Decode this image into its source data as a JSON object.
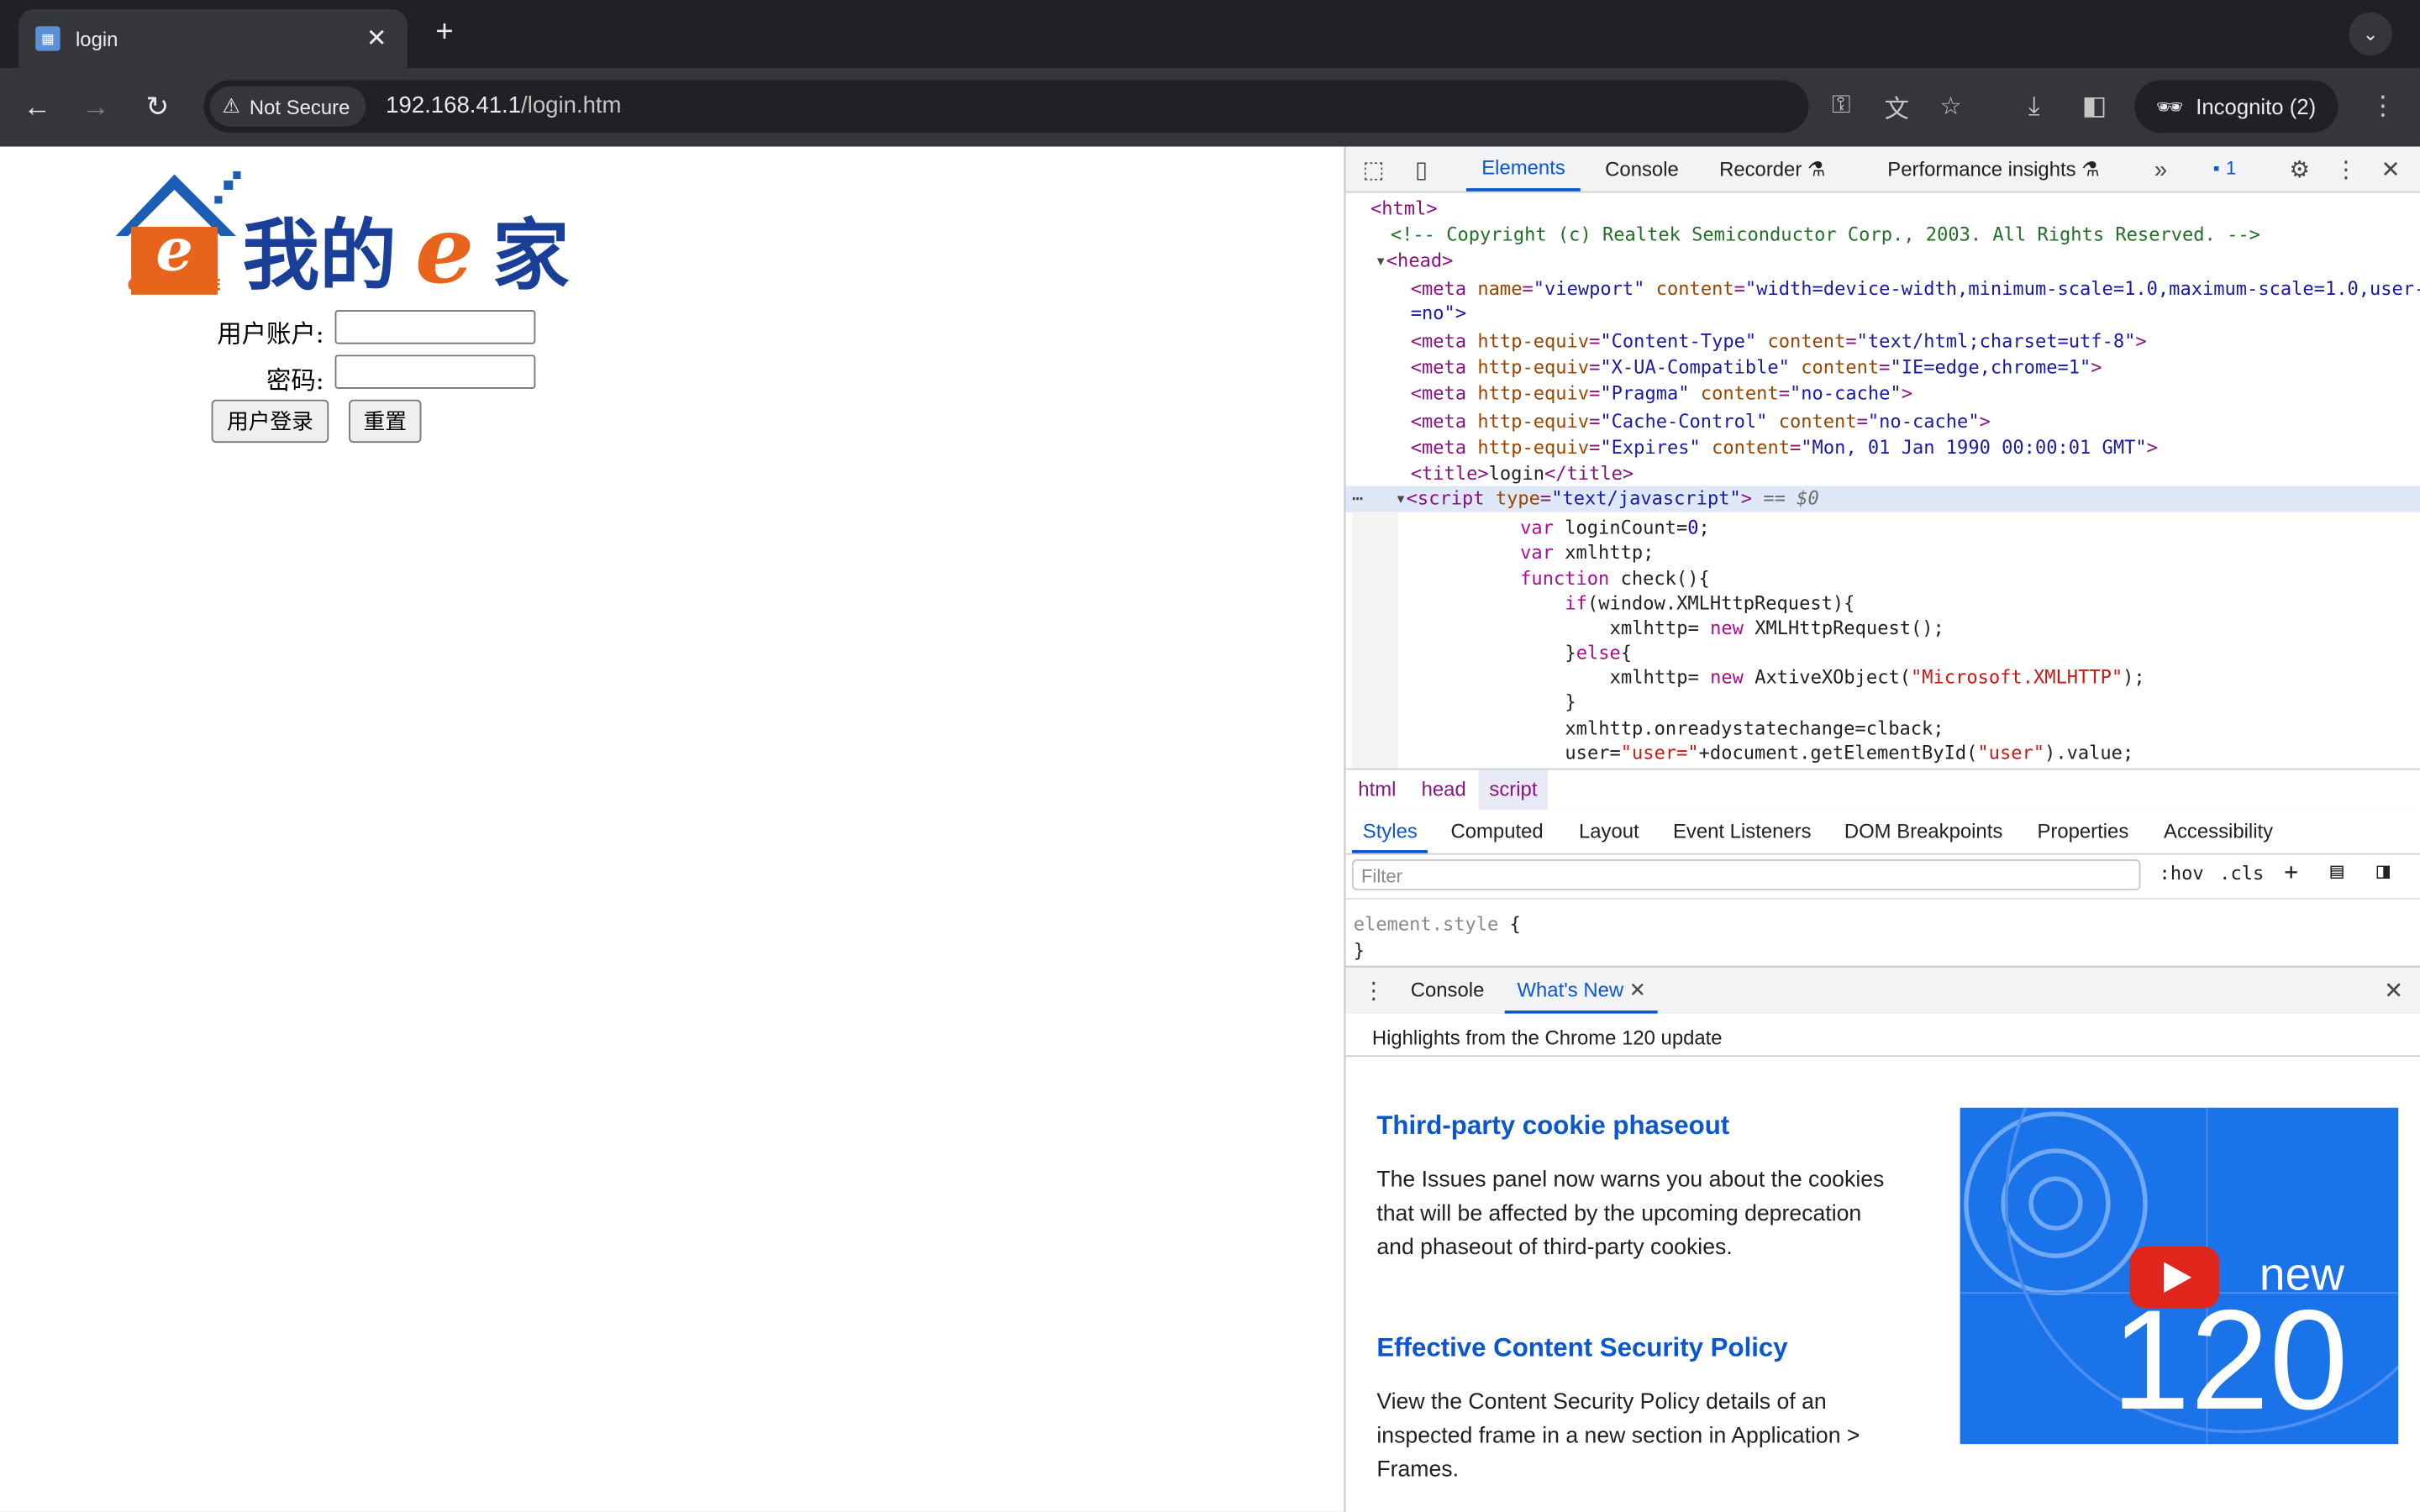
{
  "browser": {
    "tab_title": "login",
    "new_tab": "+",
    "security_label": "Not Secure",
    "url_host": "192.168.41.1",
    "url_path": "/login.htm",
    "incognito_label": "Incognito (2)"
  },
  "page": {
    "logo_text": "我的e家",
    "logo_sub": "ONE HOME",
    "username_label": "用户账户:",
    "password_label": "密码:",
    "username_value": "",
    "password_value": "",
    "login_button": "用户登录",
    "reset_button": "重置"
  },
  "devtools": {
    "tabs": [
      "Elements",
      "Console",
      "Recorder",
      "Performance insights"
    ],
    "issues_count": "1",
    "dom_lines": {
      "l1_tag": "<html>",
      "l2_comment": "<!-- Copyright (c) Realtek Semiconductor Corp., 2003. All Rights Reserved. -->",
      "l3_tag": "<head>",
      "meta1_a": "<meta ",
      "meta1_attr1": "name",
      "meta1_val1": "\"viewport\"",
      "meta1_attr2": "content",
      "meta1_val2": "\"width=device-width,minimum-scale=1.0,maximum-scale=1.0,user-",
      "meta1_cont": "=no\">",
      "meta2_attr1": "http-equiv",
      "meta2_val1": "\"Content-Type\"",
      "meta2_attr2": "content",
      "meta2_val2": "\"text/html;charset=utf-8\"",
      "meta3_val1": "\"X-UA-Compatible\"",
      "meta3_val2": "\"IE=edge,chrome=1\"",
      "meta4_val1": "\"Pragma\"",
      "meta4_val2": "\"no-cache\"",
      "meta5_val1": "\"Cache-Control\"",
      "meta5_val2": "\"no-cache\"",
      "meta6_val1": "\"Expires\"",
      "meta6_val2": "\"Mon, 01 Jan 1990 00:00:01 GMT\"",
      "title_text": "login",
      "script_type": "\"text/javascript\"",
      "script_marker": "== $0",
      "js1": "var loginCount=0;",
      "js2": "var xmlhttp;",
      "js3": "function check(){",
      "js4": "if(window.XMLHttpRequest){",
      "js5": "xmlhttp= new XMLHttpRequest();",
      "js6": "}else{",
      "js7": "xmlhttp= new AxtiveXObject(\"Microsoft.XMLHTTP\");",
      "js8": "}",
      "js9": "xmlhttp.onreadystatechange=clback;",
      "js10": "user=\"user=\"+document.getElementById(\"user\").value;"
    },
    "breadcrumbs": [
      "html",
      "head",
      "script"
    ],
    "sub_tabs": [
      "Styles",
      "Computed",
      "Layout",
      "Event Listeners",
      "DOM Breakpoints",
      "Properties",
      "Accessibility"
    ],
    "filter_placeholder": "Filter",
    "hov": ":hov",
    "cls": ".cls",
    "element_style": "element.style",
    "open_brace": "{",
    "close_brace": "}",
    "drawer_tabs": [
      "Console",
      "What's New"
    ],
    "highlights": "Highlights from the Chrome 120 update",
    "article1_title": "Third-party cookie phaseout",
    "article1_body": "The Issues panel now warns you about the cookies that will be affected by the upcoming deprecation and phaseout of third-party cookies.",
    "article2_title": "Effective Content Security Policy",
    "article2_body": "View the Content Security Policy details of an inspected frame in a new section in Application > Frames.",
    "promo_new": "new",
    "promo_version": "120"
  },
  "colors": {
    "accent": "#0b57d0",
    "tab_strip": "#202124",
    "toolbar": "#35363a"
  }
}
